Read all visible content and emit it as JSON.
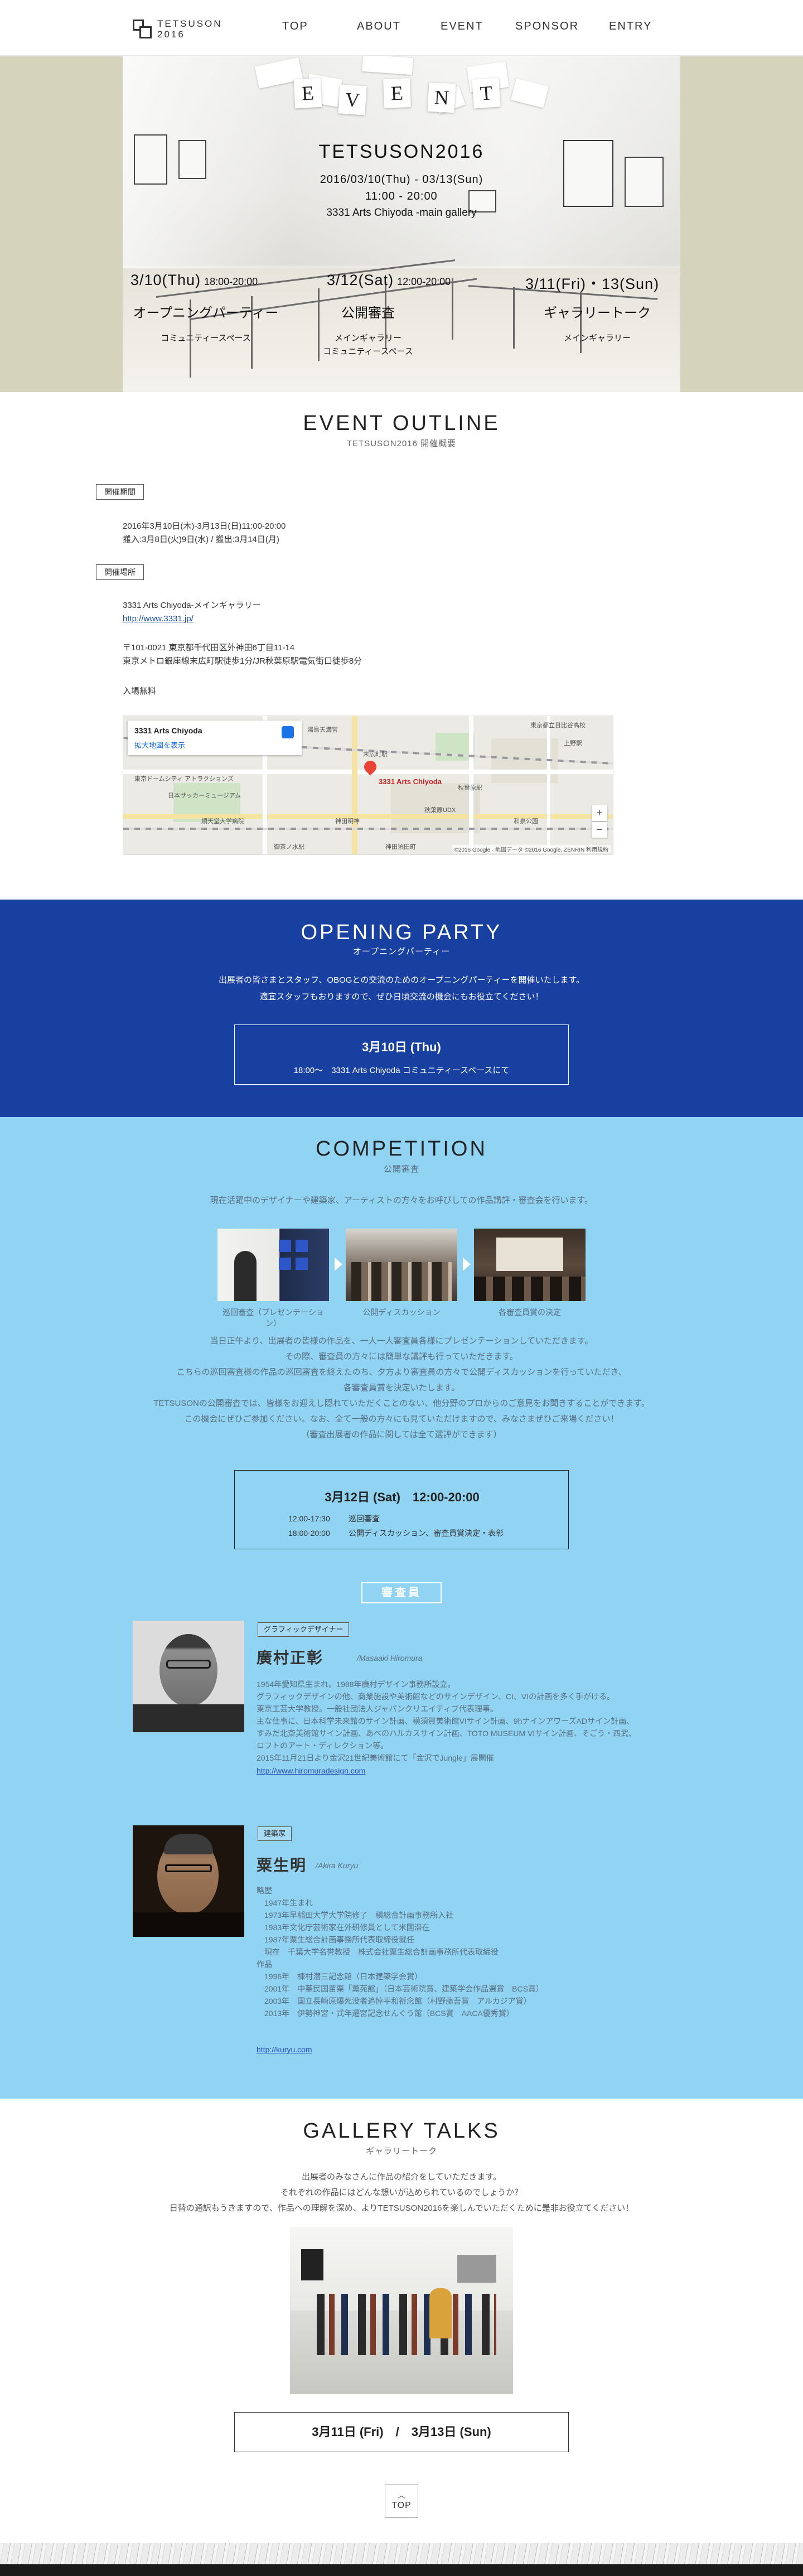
{
  "header": {
    "logo_text_line1": "TETSUSON",
    "logo_text_line2": "2016",
    "nav": [
      "TOP",
      "ABOUT",
      "EVENT",
      "SPONSOR",
      "ENTRY"
    ]
  },
  "hero": {
    "title_letters": [
      "E",
      "V",
      "E",
      "N",
      "T"
    ],
    "name": "TETSUSON2016",
    "dates": "2016/03/10(Thu) - 03/13(Sun)",
    "hours": "11:00 - 20:00",
    "venue": "3331 Arts Chiyoda -main gallery",
    "events": [
      {
        "date": "3/10(Thu)",
        "time": "18:00-20:00",
        "name": "オープニングパーティー",
        "place": "コミュニティースペース"
      },
      {
        "date": "3/12(Sat)",
        "time": "12:00-20:00",
        "name": "公開審査",
        "place": "メインギャラリー\nコミュニティースペース"
      },
      {
        "date": "3/11(Fri)・13(Sun)",
        "time": "",
        "name": "ギャラリートーク",
        "place": "メインギャラリー"
      }
    ]
  },
  "outline": {
    "title": "EVENT OUTLINE",
    "subtitle": "TETSUSON2016 開催概要",
    "period_label": "開催期間",
    "period_line1": "2016年3月10日(木)-3月13日(日)11:00-20:00",
    "period_line2": "搬入:3月8日(火)9日(水) / 搬出:3月14日(月)",
    "place_label": "開催場所",
    "place_name": "3331 Arts Chiyoda-メインギャラリー",
    "place_url": "http://www.3331.jp/",
    "address_line1": "〒101-0021 東京都千代田区外神田6丁目11-14",
    "address_line2": "東京メトロ銀座線末広町駅徒歩1分/JR秋葉原駅電気街口徒歩8分",
    "admission": "入場無料",
    "map": {
      "place": "3331 Arts Chiyoda",
      "view_larger": "拡大地図を表示",
      "pin_label": "3331 Arts Chiyoda",
      "labels": [
        "湯島天満宮",
        "末広町駅",
        "東京都立日比谷高校",
        "秋葉原駅",
        "神田明神",
        "御茶ノ水駅",
        "秋葉原UDX",
        "上野駅",
        "東京ドームシティ アトラクションズ",
        "日本サッカーミュージアム",
        "順天堂大学病院",
        "神田須田町",
        "和泉公園"
      ],
      "zoom_in": "+",
      "zoom_out": "−",
      "footer": "©2016 Google · 地図データ ©2016 Google, ZENRIN  利用規約"
    }
  },
  "party": {
    "title": "OPENING PARTY",
    "subtitle": "オープニングパーティー",
    "desc_line1": "出展者の皆さまとスタッフ、OBOGとの交流のためのオープニングパーティーを開催いたします。",
    "desc_line2": "適宜スタッフもおりますので、ぜひ日頃交流の機会にもお役立てください！",
    "date": "3月10日 (Thu)",
    "detail": "18:00〜　3331 Arts Chiyoda コミュニティースペースにて"
  },
  "competition": {
    "title": "COMPETITION",
    "subtitle": "公開審査",
    "intro": "現在活躍中のデザイナーや建築家、アーティストの方々をお呼びしての作品講評・審査会を行います。",
    "photo_captions": [
      "巡回審査（プレゼンテーション）",
      "公開ディスカッション",
      "各審査員賞の決定"
    ],
    "body": [
      "当日正午より、出展者の皆様の作品を、一人一人審査員各様にプレゼンテーションしていただきます。",
      "その際、審査員の方々には簡単な講評も行っていただきます。",
      "こちらの巡回審査様の作品の巡回審査を終えたのち、夕方より審査員の方々で公開ディスカッションを行っていただき、",
      "各審査員賞を決定いたします。",
      "TETSUSONの公開審査では、皆様をお迎えし隠れていただくことのない、他分野のプロからのご意見をお聞きすることができます。",
      "この機会にぜひご参加ください。なお、全て一般の方々にも見ていただけますので、みなさまぜひご来場ください！",
      "（審査出展者の作品に関しては全て選評ができます）"
    ],
    "date": "3月12日 (Sat)　12:00-20:00",
    "schedule": [
      {
        "time": "12:00-17:30",
        "item": "巡回審査"
      },
      {
        "time": "18:00-20:00",
        "item": "公開ディスカッション、審査員賞決定・表彰"
      }
    ],
    "judges_badge": "審査員",
    "judges": [
      {
        "role": "グラフィックデザイナー",
        "name": "廣村正彰",
        "roman": "/Masaaki Hiromura",
        "bio": [
          "1954年愛知県生まれ。1988年廣村デザイン事務所設立。",
          "グラフィックデザインの他、商業施設や美術館などのサインデザイン、CI、VIの計画を多く手がける。",
          "東京工芸大学教授。一般社団法人ジャパンクリエイティブ代表理事。",
          "主な仕事に、日本科学未来館のサイン計画、横須賀美術館VIサイン計画、9hナインアワーズADサイン計画、",
          "すみだ北斎美術館サイン計画、あべのハルカスサイン計画、TOTO MUSEUM VIサイン計画、そごう・西武、",
          "ロフトのアート・ディレクション等。",
          "2015年11月21日より金沢21世紀美術館にて「金沢でJungle」展開催"
        ],
        "link": "http://www.hiromuradesign.com"
      },
      {
        "role": "建築家",
        "name": "粟生明",
        "roman": "/Akira Kuryu",
        "bio": [
          "略歴",
          "　1947年生まれ",
          "　1973年早稲田大学大学院修了　槇総合計画事務所入社",
          "　1983年文化庁芸術家在外研修員として米国滞在",
          "　1987年粟生総合計画事務所代表取締役就任",
          "　現在　千葉大学名誉教授　株式会社粟生総合計画事務所代表取締役",
          "作品",
          "　1996年　棟村潜三記念館（日本建築学会賞）",
          "　2001年　中華民国苗栗「薫苑館」（日本芸術院賞、建築学会作品選賞　BCS賞）",
          "　2003年　国立長崎原爆死没者追悼平和祈念館（村野藤吾賞　アルカジア賞）",
          "　2013年　伊勢神宮・式年遷宮記念せんぐう館（BCS賞　AACA優秀賞）"
        ],
        "link": "http://kuryu.com"
      }
    ]
  },
  "talks": {
    "title": "GALLERY TALKS",
    "subtitle": "ギャラリートーク",
    "desc": [
      "出展者のみなさんに作品の紹介をしていただきます。",
      "それぞれの作品にはどんな想いが込められているのでしょうか？",
      "日替の通訳もうきますので、作品への理解を深め、よりTETSUSON2016を楽しんでいただくために是非お役立てください！"
    ],
    "dates": "3月11日 (Fri)　/　3月13日 (Sun)"
  },
  "footer": {
    "top_button": "TOP",
    "top_arrow": "︿"
  },
  "colors": {
    "party_blue": "#1840a0",
    "competition_sky": "#90d3f3",
    "hero_bg": "#d6d3bd"
  }
}
